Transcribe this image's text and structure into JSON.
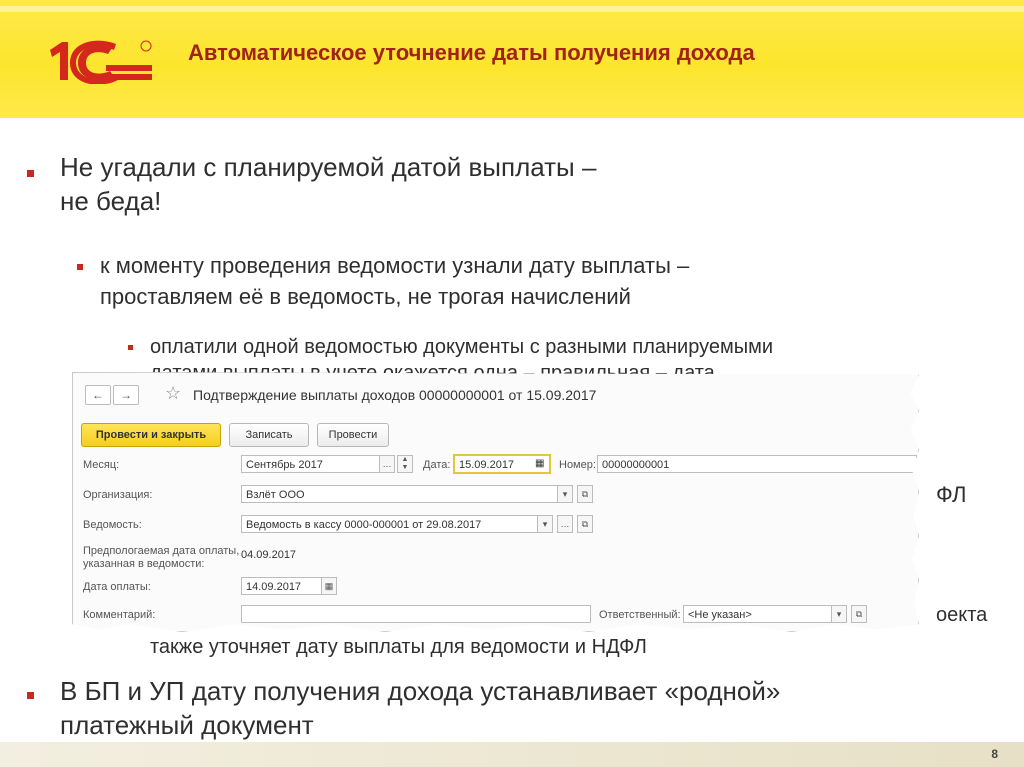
{
  "slide": {
    "title": "Автоматическое уточнение даты получения дохода",
    "logo_text": "1С",
    "page_number": "8"
  },
  "bullets": {
    "b1_line1": "Не угадали с планируемой датой выплаты –",
    "b1_line2": "не беда!",
    "b2_line1": "к моменту проведения ведомости узнали дату выплаты –",
    "b2_line2": "проставляем её в ведомость, не трогая начислений",
    "b3_line1": "оплатили одной ведомостью документы с разными планируемыми",
    "b3_line2_partial": "датами выплаты в учете окажется одна – правильная – дата",
    "right_fragment_1": "ФЛ",
    "right_fragment_2": "оекта",
    "b3_last": "также уточняет дату выплаты для ведомости и НДФЛ",
    "b4_line1": "В БП и УП дату получения дохода устанавливает «родной»",
    "b4_line2": "платежный документ"
  },
  "window": {
    "title": "Подтверждение выплаты доходов 00000000001 от 15.09.2017",
    "nav": {
      "back": "←",
      "forward": "→",
      "star": "☆"
    },
    "buttons": {
      "post_close": "Провести и закрыть",
      "save": "Записать",
      "post": "Провести"
    },
    "fields": {
      "month_label": "Месяц:",
      "month_value": "Сентябрь 2017",
      "date_label": "Дата:",
      "date_value": "15.09.2017",
      "number_label": "Номер:",
      "number_value": "00000000001",
      "org_label": "Организация:",
      "org_value": "Взлёт ООО",
      "statement_label": "Ведомость:",
      "statement_value": "Ведомость в кассу 0000-000001 от 29.08.2017",
      "planned_label_1": "Предпологаемая дата оплаты,",
      "planned_label_2": "указанная в ведомости:",
      "planned_value": "04.09.2017",
      "pay_date_label": "Дата оплаты:",
      "pay_date_value": "14.09.2017",
      "comment_label": "Комментарий:",
      "responsible_label": "Ответственный:",
      "responsible_value": "<Не указан>"
    }
  },
  "colors": {
    "header_yellow": "#fde52e",
    "title_red": "#a12318",
    "bullet_red": "#c8281e",
    "button_yellow": "#f5cf1b"
  }
}
